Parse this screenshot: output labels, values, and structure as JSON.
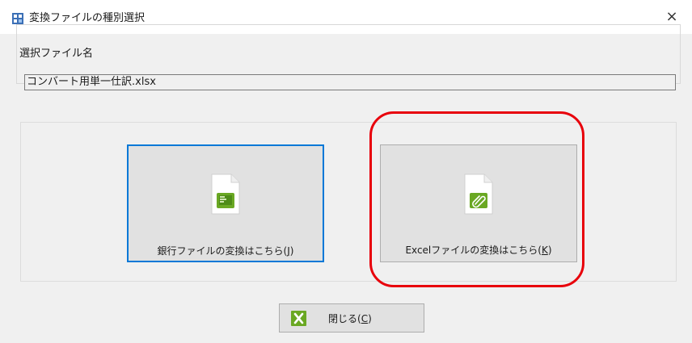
{
  "window": {
    "title": "変換ファイルの種別選択",
    "close_glyph": "×"
  },
  "file_group": {
    "label": "選択ファイル名",
    "filename": "コンバート用単一仕訳.xlsx"
  },
  "buttons": {
    "bank": {
      "label_prefix": "銀行ファイルの変換はこちら(",
      "accel": "J",
      "label_suffix": ")"
    },
    "excel": {
      "label_prefix": "Excelファイルの変換はこちら(",
      "accel": "K",
      "label_suffix": ")"
    },
    "close": {
      "label_prefix": "閉じる(",
      "accel": "C",
      "label_suffix": ")"
    }
  },
  "icons": {
    "app": "app-icon",
    "bank_file": "bank-file-icon",
    "excel_file": "excel-file-icon",
    "close": "close-x-icon"
  },
  "colors": {
    "focus_border": "#0078d7",
    "highlight_ring": "#e8000b",
    "icon_green": "#6aa823"
  }
}
